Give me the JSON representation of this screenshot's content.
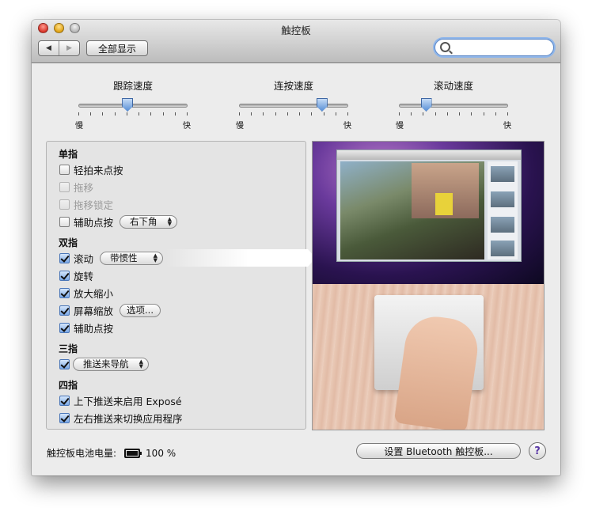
{
  "window": {
    "title": "触控板"
  },
  "toolbar": {
    "back_icon": "back-arrow-icon",
    "forward_icon": "forward-arrow-icon",
    "show_all_label": "全部显示",
    "search_placeholder": ""
  },
  "speeds": [
    {
      "label": "跟踪速度",
      "min_label": "慢",
      "max_label": "快",
      "value": 0.45,
      "tick_count": 10
    },
    {
      "label": "连按速度",
      "min_label": "慢",
      "max_label": "快",
      "value": 0.76,
      "tick_count": 10
    },
    {
      "label": "滚动速度",
      "min_label": "慢",
      "max_label": "快",
      "value": 0.25,
      "tick_count": 10
    }
  ],
  "gestures": {
    "one_finger": {
      "title": "单指",
      "items": [
        {
          "label": "轻拍来点按",
          "checked": false,
          "enabled": true
        },
        {
          "label": "拖移",
          "checked": false,
          "enabled": false
        },
        {
          "label": "拖移锁定",
          "checked": false,
          "enabled": false
        },
        {
          "label": "辅助点按",
          "checked": false,
          "enabled": true,
          "popup": "右下角"
        }
      ]
    },
    "two_fingers": {
      "title": "双指",
      "items": [
        {
          "label": "滚动",
          "checked": true,
          "popup": "带惯性"
        },
        {
          "label": "旋转",
          "checked": true
        },
        {
          "label": "放大缩小",
          "checked": true
        },
        {
          "label": "屏幕缩放",
          "checked": true,
          "button": "选项..."
        },
        {
          "label": "辅助点按",
          "checked": true
        }
      ]
    },
    "three_fingers": {
      "title": "三指",
      "items": [
        {
          "label": "",
          "checked": true,
          "popup": "推送来导航"
        }
      ]
    },
    "four_fingers": {
      "title": "四指",
      "items": [
        {
          "label": "上下推送来启用 Exposé",
          "checked": true
        },
        {
          "label": "左右推送来切换应用程序",
          "checked": true
        }
      ]
    }
  },
  "footer": {
    "battery_label": "触控板电池电量:",
    "battery_icon": "battery-icon",
    "battery_level": "100 %",
    "setup_button": "设置 Bluetooth 触控板...",
    "help_label": "?"
  }
}
